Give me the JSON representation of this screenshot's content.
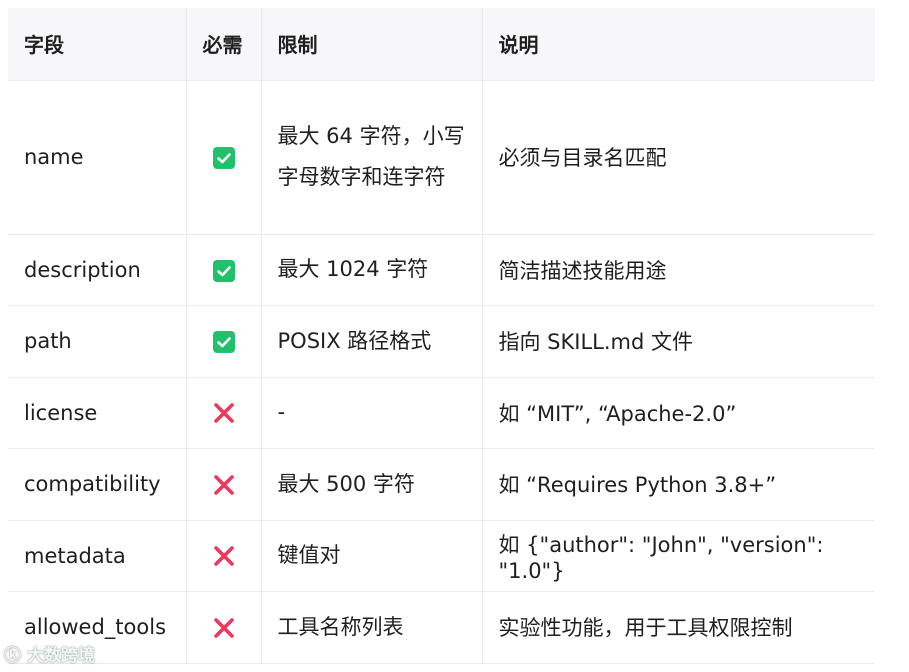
{
  "headers": [
    "字段",
    "必需",
    "限制",
    "说明"
  ],
  "rows": [
    {
      "field": "name",
      "required": true,
      "limit": "最大 64 字符，小写字母数字和连字符",
      "desc": "必须与目录名匹配"
    },
    {
      "field": "description",
      "required": true,
      "limit": "最大 1024 字符",
      "desc": "简洁描述技能用途"
    },
    {
      "field": "path",
      "required": true,
      "limit": "POSIX 路径格式",
      "desc": "指向 SKILL.md 文件"
    },
    {
      "field": "license",
      "required": false,
      "limit": "-",
      "desc": "如 “MIT”, “Apache-2.0”"
    },
    {
      "field": "compatibility",
      "required": false,
      "limit": "最大 500 字符",
      "desc": "如 “Requires Python 3.8+”"
    },
    {
      "field": "metadata",
      "required": false,
      "limit": "键值对",
      "desc": "如 {\"author\": \"John\", \"version\": \"1.0\"}"
    },
    {
      "field": "allowed_tools",
      "required": false,
      "limit": "工具名称列表",
      "desc": "实验性功能，用于工具权限控制"
    }
  ],
  "icons": {
    "yes": "checkbox-checked-icon",
    "no": "cross-icon"
  },
  "colors": {
    "check": "#1fc26b",
    "cross": "#f0365a",
    "header_bg": "#f7f7fa",
    "border": "#e9e9ee"
  },
  "watermark": "大数跨境"
}
